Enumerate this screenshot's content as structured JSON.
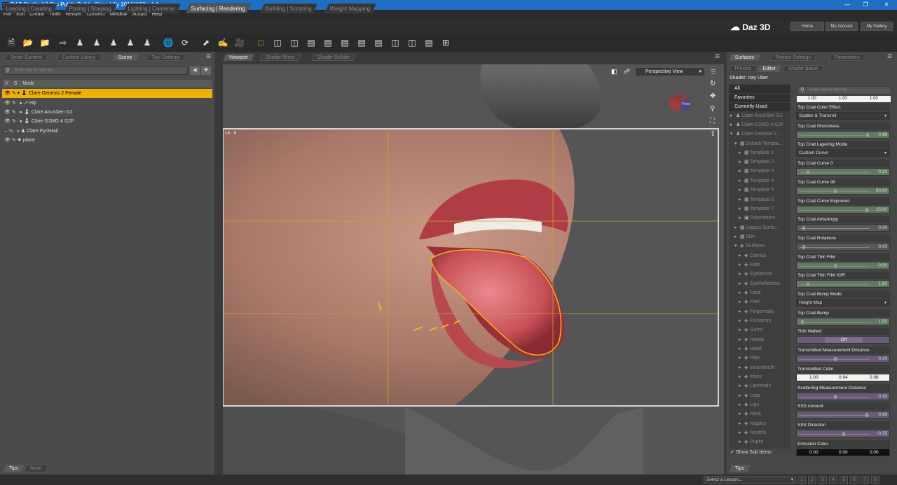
{
  "window": {
    "title": "DAZ Studio 4.9 Pro Public Build - Clare Lilly 20161103a.duf",
    "app_icon": "DS"
  },
  "menu": [
    "File",
    "Edit",
    "Create",
    "Tools",
    "Render",
    "Connect",
    "Window",
    "Scripts",
    "Help"
  ],
  "layout_tabs": [
    "Loading | Creating",
    "Posing | Shaping",
    "Lighting | Cameras",
    "Surfacing | Rendering",
    "Building | Scripting",
    "Weight Mapping"
  ],
  "active_layout_tab": "Surfacing | Rendering",
  "brand": {
    "logo": "Daz 3D",
    "home": "Home",
    "account": "My Account",
    "gallery": "My Gallery"
  },
  "left_tabs": [
    "Smart Content",
    "Content Library",
    "Scene",
    "Tool Settings"
  ],
  "active_left_tab": "Scene",
  "scene": {
    "filter_placeholder": "Enter text to filter by...",
    "col_v": "V",
    "col_s": "S",
    "col_node": "Node",
    "nodes": [
      {
        "label": "Clare Genesis 2 Female",
        "selected": true
      },
      {
        "label": "Hip"
      },
      {
        "label": "Clare AnusGen G2"
      },
      {
        "label": "Clare G2MG 4 G2F"
      },
      {
        "label": "Clare PyritHair"
      },
      {
        "label": "plane"
      }
    ]
  },
  "bottom_left_tabs": [
    "Tips",
    "Node"
  ],
  "view_tabs": [
    "Viewport",
    "Shader Mixer",
    "Shader Builder"
  ],
  "viewport": {
    "camera": "Perspective View",
    "aspect": "16 : 9",
    "cube_label": "Front"
  },
  "right_tabs": [
    "Surfaces",
    "Render Settings",
    "Parameters"
  ],
  "right_subtabs": [
    "Presets",
    "Editor",
    "Shader Baker"
  ],
  "shader": "Shader: Iray Uber",
  "surface_filter_placeholder": "Enter text to filter by...",
  "surface_tree": [
    {
      "label": "All",
      "active": true
    },
    {
      "label": "Favorites",
      "active": true
    },
    {
      "label": "Currently Used",
      "active": true
    },
    {
      "label": "Clare AnusGen G2"
    },
    {
      "label": "Clare G2MG 4 G2F"
    },
    {
      "label": "Clare Genesis 2 ..."
    },
    {
      "label": "Default Templa..."
    },
    {
      "label": "Template 1"
    },
    {
      "label": "Template 2"
    },
    {
      "label": "Template 3"
    },
    {
      "label": "Template 4"
    },
    {
      "label": "Template 5"
    },
    {
      "label": "Template 6"
    },
    {
      "label": "Template 7"
    },
    {
      "label": "Parameters"
    },
    {
      "label": "Legacy Surfa..."
    },
    {
      "label": "Skin"
    },
    {
      "label": "Surfaces"
    },
    {
      "label": "Cornea"
    },
    {
      "label": "Ears"
    },
    {
      "label": "Eyelashes"
    },
    {
      "label": "EyeReflection"
    },
    {
      "label": "Face"
    },
    {
      "label": "Feet"
    },
    {
      "label": "Fingernails"
    },
    {
      "label": "Forearms"
    },
    {
      "label": "Gums"
    },
    {
      "label": "Hands"
    },
    {
      "label": "Head"
    },
    {
      "label": "Hips"
    },
    {
      "label": "InnerMouth"
    },
    {
      "label": "Irises"
    },
    {
      "label": "Lacrimals"
    },
    {
      "label": "Legs"
    },
    {
      "label": "Lips"
    },
    {
      "label": "Neck"
    },
    {
      "label": "Nipples"
    },
    {
      "label": "Nostrils"
    },
    {
      "label": "Pupils"
    }
  ],
  "show_sub_items": "Show Sub Items",
  "top_values": [
    "1.00",
    "1.00",
    "1.00"
  ],
  "props": [
    {
      "label": "Top Coat Color Effect",
      "type": "dd",
      "value": "Scatter & Transmit"
    },
    {
      "label": "Top Coat Glossiness",
      "type": "g",
      "value": "0.98",
      "pos": 0.97
    },
    {
      "label": "Top Coat Layering Mode",
      "type": "dd",
      "value": "Custom Curve"
    },
    {
      "label": "Top Coat Curve 0",
      "type": "g",
      "value": "0.10",
      "pos": 0.1
    },
    {
      "label": "Top Coat Curve 90",
      "type": "g",
      "value": "50.00",
      "pos": 0.5
    },
    {
      "label": "Top Coat Curve Exponent",
      "type": "g",
      "value": "15.00",
      "pos": 0.96
    },
    {
      "label": "Top Coat Anisotropy",
      "type": "d",
      "value": "0.00",
      "pos": 0.04
    },
    {
      "label": "Top Coat Rotations",
      "type": "d",
      "value": "0.00",
      "pos": 0.04
    },
    {
      "label": "Top Coat Thin Film",
      "type": "g",
      "value": "0.00",
      "pos": 0.5
    },
    {
      "label": "Top Coat Thin Film IOR",
      "type": "g",
      "value": "1.50",
      "pos": 0.1
    },
    {
      "label": "Top Coat Bump Mode",
      "type": "dd",
      "value": "Height Map"
    },
    {
      "label": "Top Coat Bump",
      "type": "g",
      "value": "1.00",
      "pos": 0.02
    },
    {
      "label": "Thin Walled",
      "type": "btn",
      "value": "Off"
    },
    {
      "label": "Transmitted Measurement Distance",
      "type": "p",
      "value": "0.10",
      "pos": 0.5
    },
    {
      "label": "Transmitted Color",
      "type": "rgb",
      "value": [
        "1.00",
        "0.94",
        "0.88"
      ]
    },
    {
      "label": "Scattering Measurement Distance",
      "type": "p",
      "value": "0.10",
      "pos": 0.5
    },
    {
      "label": "SSS Amount",
      "type": "p",
      "value": "0.99",
      "pos": 0.96
    },
    {
      "label": "SSS Direction",
      "type": "p",
      "value": "-0.35",
      "pos": 0.62
    },
    {
      "label": "Emission Color",
      "type": "rgbdark",
      "value": [
        "0.00",
        "0.00",
        "0.00"
      ]
    }
  ],
  "bottom_right_tab": "Tips",
  "status": {
    "lesson": "Select a Lesson...",
    "pages": [
      "1",
      "2",
      "3",
      "4",
      "5",
      "6",
      "7",
      "8"
    ]
  }
}
